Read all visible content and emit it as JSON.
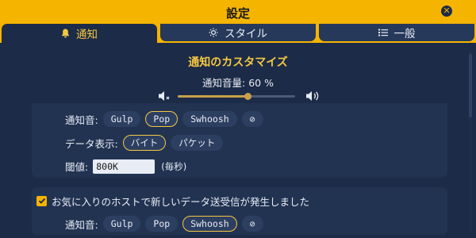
{
  "window": {
    "title": "設定"
  },
  "tabs": [
    {
      "label": "通知",
      "icon": "bell-icon",
      "active": true
    },
    {
      "label": "スタイル",
      "icon": "sun-icon",
      "active": false
    },
    {
      "label": "一般",
      "icon": "list-icon",
      "active": false
    }
  ],
  "section": {
    "title": "通知のカスタマイズ",
    "volume_label": "通知音量: 60 %",
    "volume_value": 0.6
  },
  "card1": {
    "sound_label": "通知音:",
    "sounds": [
      "Gulp",
      "Pop",
      "Swhoosh"
    ],
    "selected_sound": "Pop",
    "data_label": "データ表示:",
    "data_options": [
      "バイト",
      "パケット"
    ],
    "selected_data": "バイト",
    "threshold_label": "閾値:",
    "threshold_value": "800K",
    "threshold_unit": "(毎秒)"
  },
  "card2": {
    "checkbox_label": "お気に入りのホストで新しいデータ送受信が発生しました",
    "checked": true,
    "sound_label": "通知音:",
    "sounds": [
      "Gulp",
      "Pop",
      "Swhoosh"
    ],
    "selected_sound": "Swhoosh"
  },
  "colors": {
    "accent": "#f5b400",
    "background": "#1c2b47",
    "card": "#223352"
  }
}
